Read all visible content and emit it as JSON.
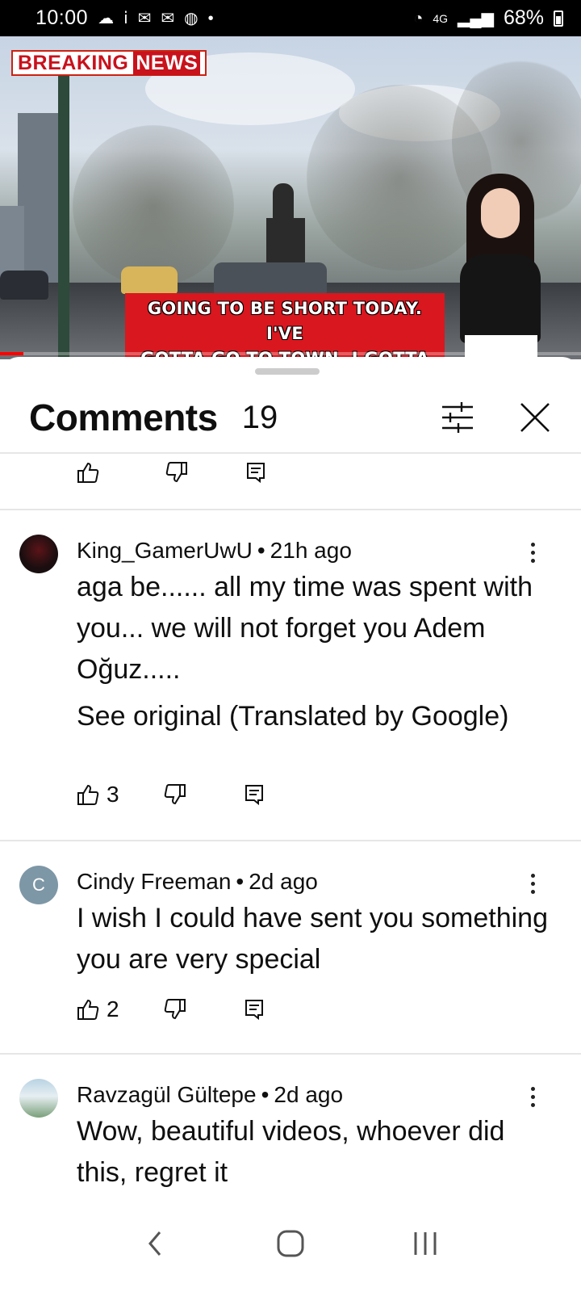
{
  "status_bar": {
    "time": "10:00",
    "network": "4G",
    "battery": "68%"
  },
  "video": {
    "badge_word1": "BREAKING",
    "badge_word2": "NEWS",
    "caption_line1": "GOING TO BE SHORT TODAY. I'VE",
    "caption_line2": "GOTTA GO TO TOWN. I GOTTA GET",
    "progress": 0.04
  },
  "comments_panel": {
    "title": "Comments",
    "count": "19",
    "filter_icon": "sliders-icon",
    "close_icon": "close-icon"
  },
  "comments": [
    {
      "author": "King_GamerUwU",
      "time": "21h ago",
      "text": "aga be...... all my time was spent with you... we will not forget you Adem Oğuz.....",
      "see_original": "See original (Translated by Google)",
      "likes": "3",
      "avatar_color": "#1a0e10"
    },
    {
      "author": "Cindy Freeman",
      "time": "2d ago",
      "text": "I wish I could have sent you something you are very special",
      "likes": "2",
      "avatar_letter": "C",
      "avatar_color": "#7d97a6"
    },
    {
      "author": "Ravzagül Gültepe",
      "time": "2d ago",
      "text": "Wow, beautiful videos, whoever did this, regret it",
      "avatar_color": "#8fb3c9"
    }
  ],
  "nav": {
    "back_icon": "back-icon",
    "home_icon": "home-icon",
    "recents_icon": "recents-icon"
  }
}
